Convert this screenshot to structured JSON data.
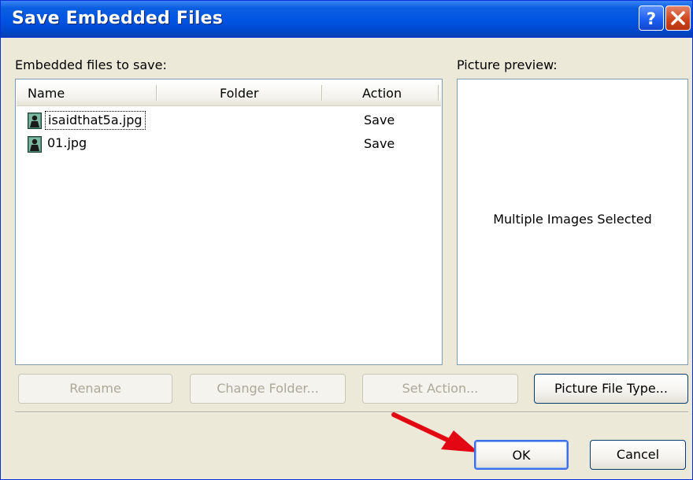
{
  "title": "Save Embedded Files",
  "embedded_label": "Embedded files to save:",
  "preview_label": "Picture preview:",
  "columns": {
    "name": "Name",
    "folder": "Folder",
    "action": "Action"
  },
  "files": [
    {
      "name": "isaidthat5a.jpg",
      "folder": "",
      "action": "Save"
    },
    {
      "name": "01.jpg",
      "folder": "",
      "action": "Save"
    }
  ],
  "preview_text": "Multiple Images Selected",
  "buttons": {
    "rename": "Rename",
    "change_folder": "Change Folder...",
    "set_action": "Set Action...",
    "picture_file_type": "Picture File Type...",
    "ok": "OK",
    "cancel": "Cancel"
  },
  "colors": {
    "title_bar": "#0054e3",
    "close_button": "#d0451b",
    "annotation_arrow": "#e30613"
  }
}
